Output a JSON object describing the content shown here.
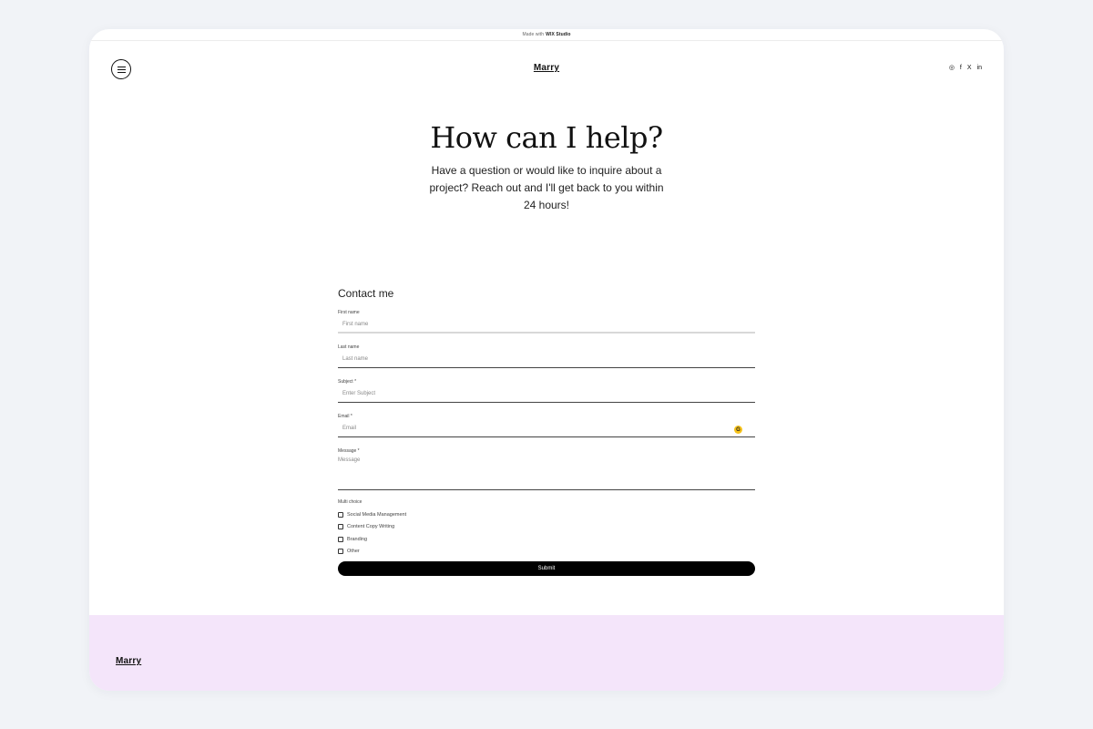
{
  "banner": {
    "prefix": "Made with",
    "brand": "WIX Studio"
  },
  "header": {
    "menu_icon": "hamburger-icon",
    "site_title": "Marry",
    "social": [
      {
        "name": "instagram-icon",
        "glyph": "◎"
      },
      {
        "name": "facebook-icon",
        "glyph": "f"
      },
      {
        "name": "x-icon",
        "glyph": "X"
      },
      {
        "name": "linkedin-icon",
        "glyph": "in"
      }
    ]
  },
  "hero": {
    "title": "How can I help?",
    "subtitle": "Have a question or would like to inquire about a project? Reach out and I'll get back to you within 24 hours!"
  },
  "form": {
    "title": "Contact me",
    "fields": {
      "first_name": {
        "label": "First name",
        "placeholder": "First name"
      },
      "last_name": {
        "label": "Last name",
        "placeholder": "Last name"
      },
      "subject": {
        "label": "Subject *",
        "placeholder": "Enter Subject"
      },
      "email": {
        "label": "Email *",
        "placeholder": "Email",
        "icon": "grammarly-icon",
        "icon_glyph": "G"
      },
      "message": {
        "label": "Message *",
        "placeholder": "Message"
      }
    },
    "multi_choice": {
      "label": "Multi choice",
      "options": [
        "Social Media Management",
        "Content Copy Writing",
        "Branding",
        "Other"
      ]
    },
    "submit_label": "Submit"
  },
  "footer": {
    "logo": "Marry",
    "background": "#f4e5fa"
  }
}
